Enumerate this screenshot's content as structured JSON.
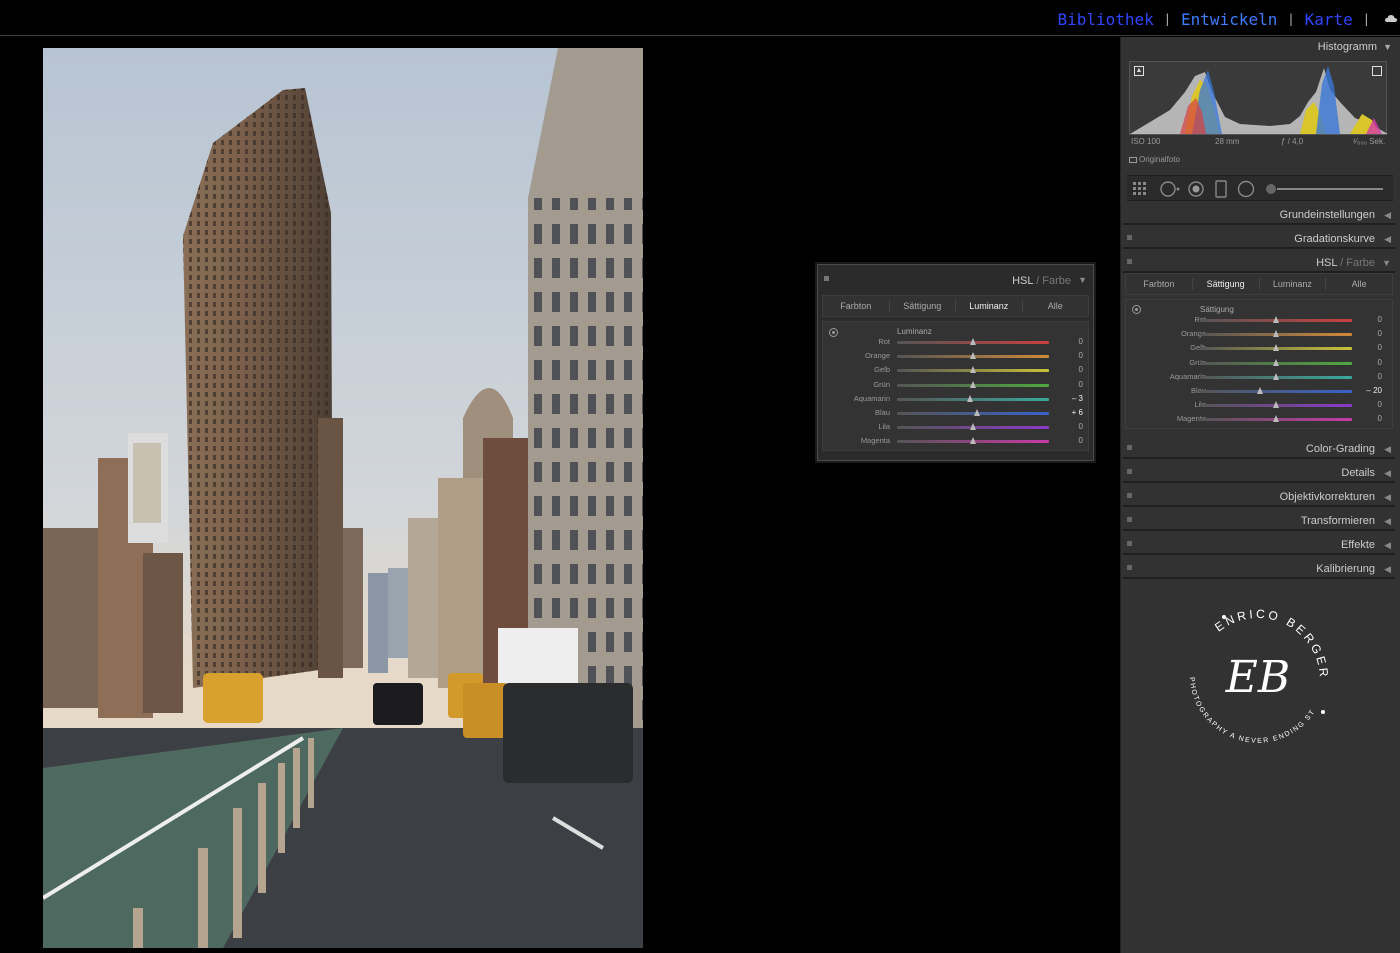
{
  "modules": [
    {
      "label": "Bibliothek",
      "active": false
    },
    {
      "label": "Entwickeln",
      "active": true
    },
    {
      "label": "Karte",
      "active": false
    }
  ],
  "module_separator": "|",
  "icons": {
    "cloud": "cloud-sync-icon",
    "target": "target-adjust-icon"
  },
  "hsl_floating": {
    "title_main": "HSL",
    "title_sub": " / Farbe",
    "tabs": [
      "Farbton",
      "Sättigung",
      "Luminanz",
      "Alle"
    ],
    "active_tab": "Luminanz",
    "section_label": "Luminanz",
    "rows": [
      {
        "label": "Rot",
        "value": "0",
        "level": 0.5
      },
      {
        "label": "Orange",
        "value": "0",
        "level": 0.5
      },
      {
        "label": "Gelb",
        "value": "0",
        "level": 0.5
      },
      {
        "label": "Grün",
        "value": "0",
        "level": 0.5
      },
      {
        "label": "Aquamarin",
        "value": "– 3",
        "level": 0.485
      },
      {
        "label": "Blau",
        "value": "+ 6",
        "level": 0.53
      },
      {
        "label": "Lila",
        "value": "0",
        "level": 0.5
      },
      {
        "label": "Magenta",
        "value": "0",
        "level": 0.5
      }
    ]
  },
  "right_panel": {
    "histogram_title": "Histogramm",
    "exif": {
      "iso": "ISO 100",
      "focal": "28 mm",
      "aperture": "ƒ / 4,0",
      "shutter": "¹⁄₈₀₀ Sek."
    },
    "original_label": "Originalfoto",
    "sections_top": [
      "Grundeinstellungen",
      "Gradationskurve"
    ],
    "hsl": {
      "title_main": "HSL",
      "title_sub": " / Farbe",
      "tabs": [
        "Farbton",
        "Sättigung",
        "Luminanz",
        "Alle"
      ],
      "active_tab": "Sättigung",
      "section_label": "Sättigung",
      "rows": [
        {
          "label": "Rot",
          "value": "0",
          "level": 0.5
        },
        {
          "label": "Orange",
          "value": "0",
          "level": 0.5
        },
        {
          "label": "Gelb",
          "value": "0",
          "level": 0.5
        },
        {
          "label": "Grün",
          "value": "0",
          "level": 0.5
        },
        {
          "label": "Aquamarin",
          "value": "0",
          "level": 0.5
        },
        {
          "label": "Blau",
          "value": "– 20",
          "level": 0.4
        },
        {
          "label": "Lila",
          "value": "0",
          "level": 0.5
        },
        {
          "label": "Magenta",
          "value": "0",
          "level": 0.5
        }
      ]
    },
    "sections_bottom": [
      "Color-Grading",
      "Details",
      "Objektivkorrekturen",
      "Transformieren",
      "Effekte",
      "Kalibrierung"
    ]
  },
  "logo": {
    "top_text": "ENRICO BERGER",
    "bottom_text": "PHOTOGRAPHY A NEVER ENDING STORY",
    "monogram": "EB"
  },
  "colors": {
    "Rot": "#c8403f",
    "Orange": "#d08a3a",
    "Gelb": "#c8c23a",
    "Grün": "#4fa83f",
    "Aquamarin": "#3aa89c",
    "Blau": "#3a62c8",
    "Lila": "#8a3ac8",
    "Magenta": "#c83aa8",
    "module_link": "#2f46ff"
  }
}
